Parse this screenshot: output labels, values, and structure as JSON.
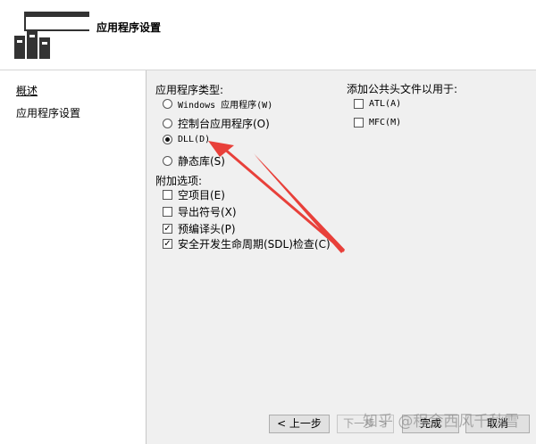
{
  "header": {
    "title": "应用程序设置"
  },
  "sidebar": {
    "items": [
      {
        "label": "概述"
      },
      {
        "label": "应用程序设置"
      }
    ]
  },
  "app_type": {
    "heading": "应用程序类型:",
    "options": [
      {
        "label": "Windows 应用程序(W)",
        "selected": false
      },
      {
        "label": "控制台应用程序(O)",
        "selected": false
      },
      {
        "label": "DLL(D)",
        "selected": true
      },
      {
        "label": "静态库(S)",
        "selected": false
      }
    ]
  },
  "extra_options": {
    "heading": "附加选项:",
    "items": [
      {
        "label": "空项目(E)",
        "checked": false
      },
      {
        "label": "导出符号(X)",
        "checked": false
      },
      {
        "label": "预编译头(P)",
        "checked": true
      },
      {
        "label": "安全开发生命周期(SDL)检查(C)",
        "checked": true
      }
    ]
  },
  "common_headers": {
    "heading": "添加公共头文件以用于:",
    "items": [
      {
        "label": "ATL(A)",
        "checked": false
      },
      {
        "label": "MFC(M)",
        "checked": false
      }
    ]
  },
  "buttons": {
    "prev": "< 上一步",
    "next": "下一步 >",
    "finish": "完成",
    "cancel": "取消"
  },
  "watermark": "知乎 @程余西风千秋雪",
  "colors": {
    "arrow": "#e8403a"
  }
}
